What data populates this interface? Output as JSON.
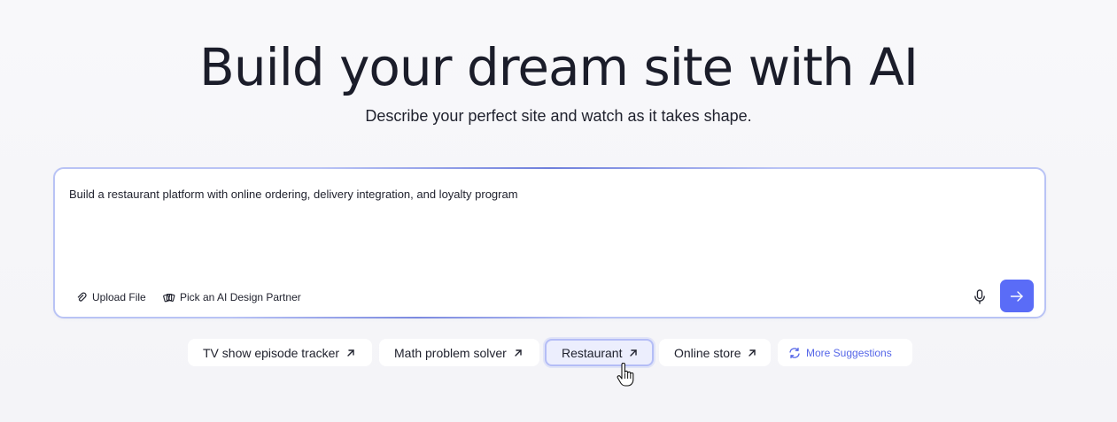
{
  "hero": {
    "title": "Build your dream site with AI",
    "subtitle": "Describe your perfect site and watch as it takes shape."
  },
  "prompt": {
    "text": "Build a restaurant platform with online ordering, delivery integration, and loyalty program",
    "upload_label": "Upload File",
    "partner_label": "Pick an AI Design Partner",
    "icons": {
      "upload": "paperclip-icon",
      "partner": "cards-icon",
      "mic": "microphone-icon",
      "send": "arrow-right-icon"
    }
  },
  "suggestions": {
    "chips": [
      {
        "label": "TV show episode tracker",
        "selected": false
      },
      {
        "label": "Math problem solver",
        "selected": false
      },
      {
        "label": "Restaurant",
        "selected": true
      },
      {
        "label": "Online store",
        "selected": false
      }
    ],
    "more_label": "More Suggestions"
  },
  "colors": {
    "accent": "#5a6cf7",
    "border": "#b9c3f5",
    "link": "#5566e8"
  }
}
